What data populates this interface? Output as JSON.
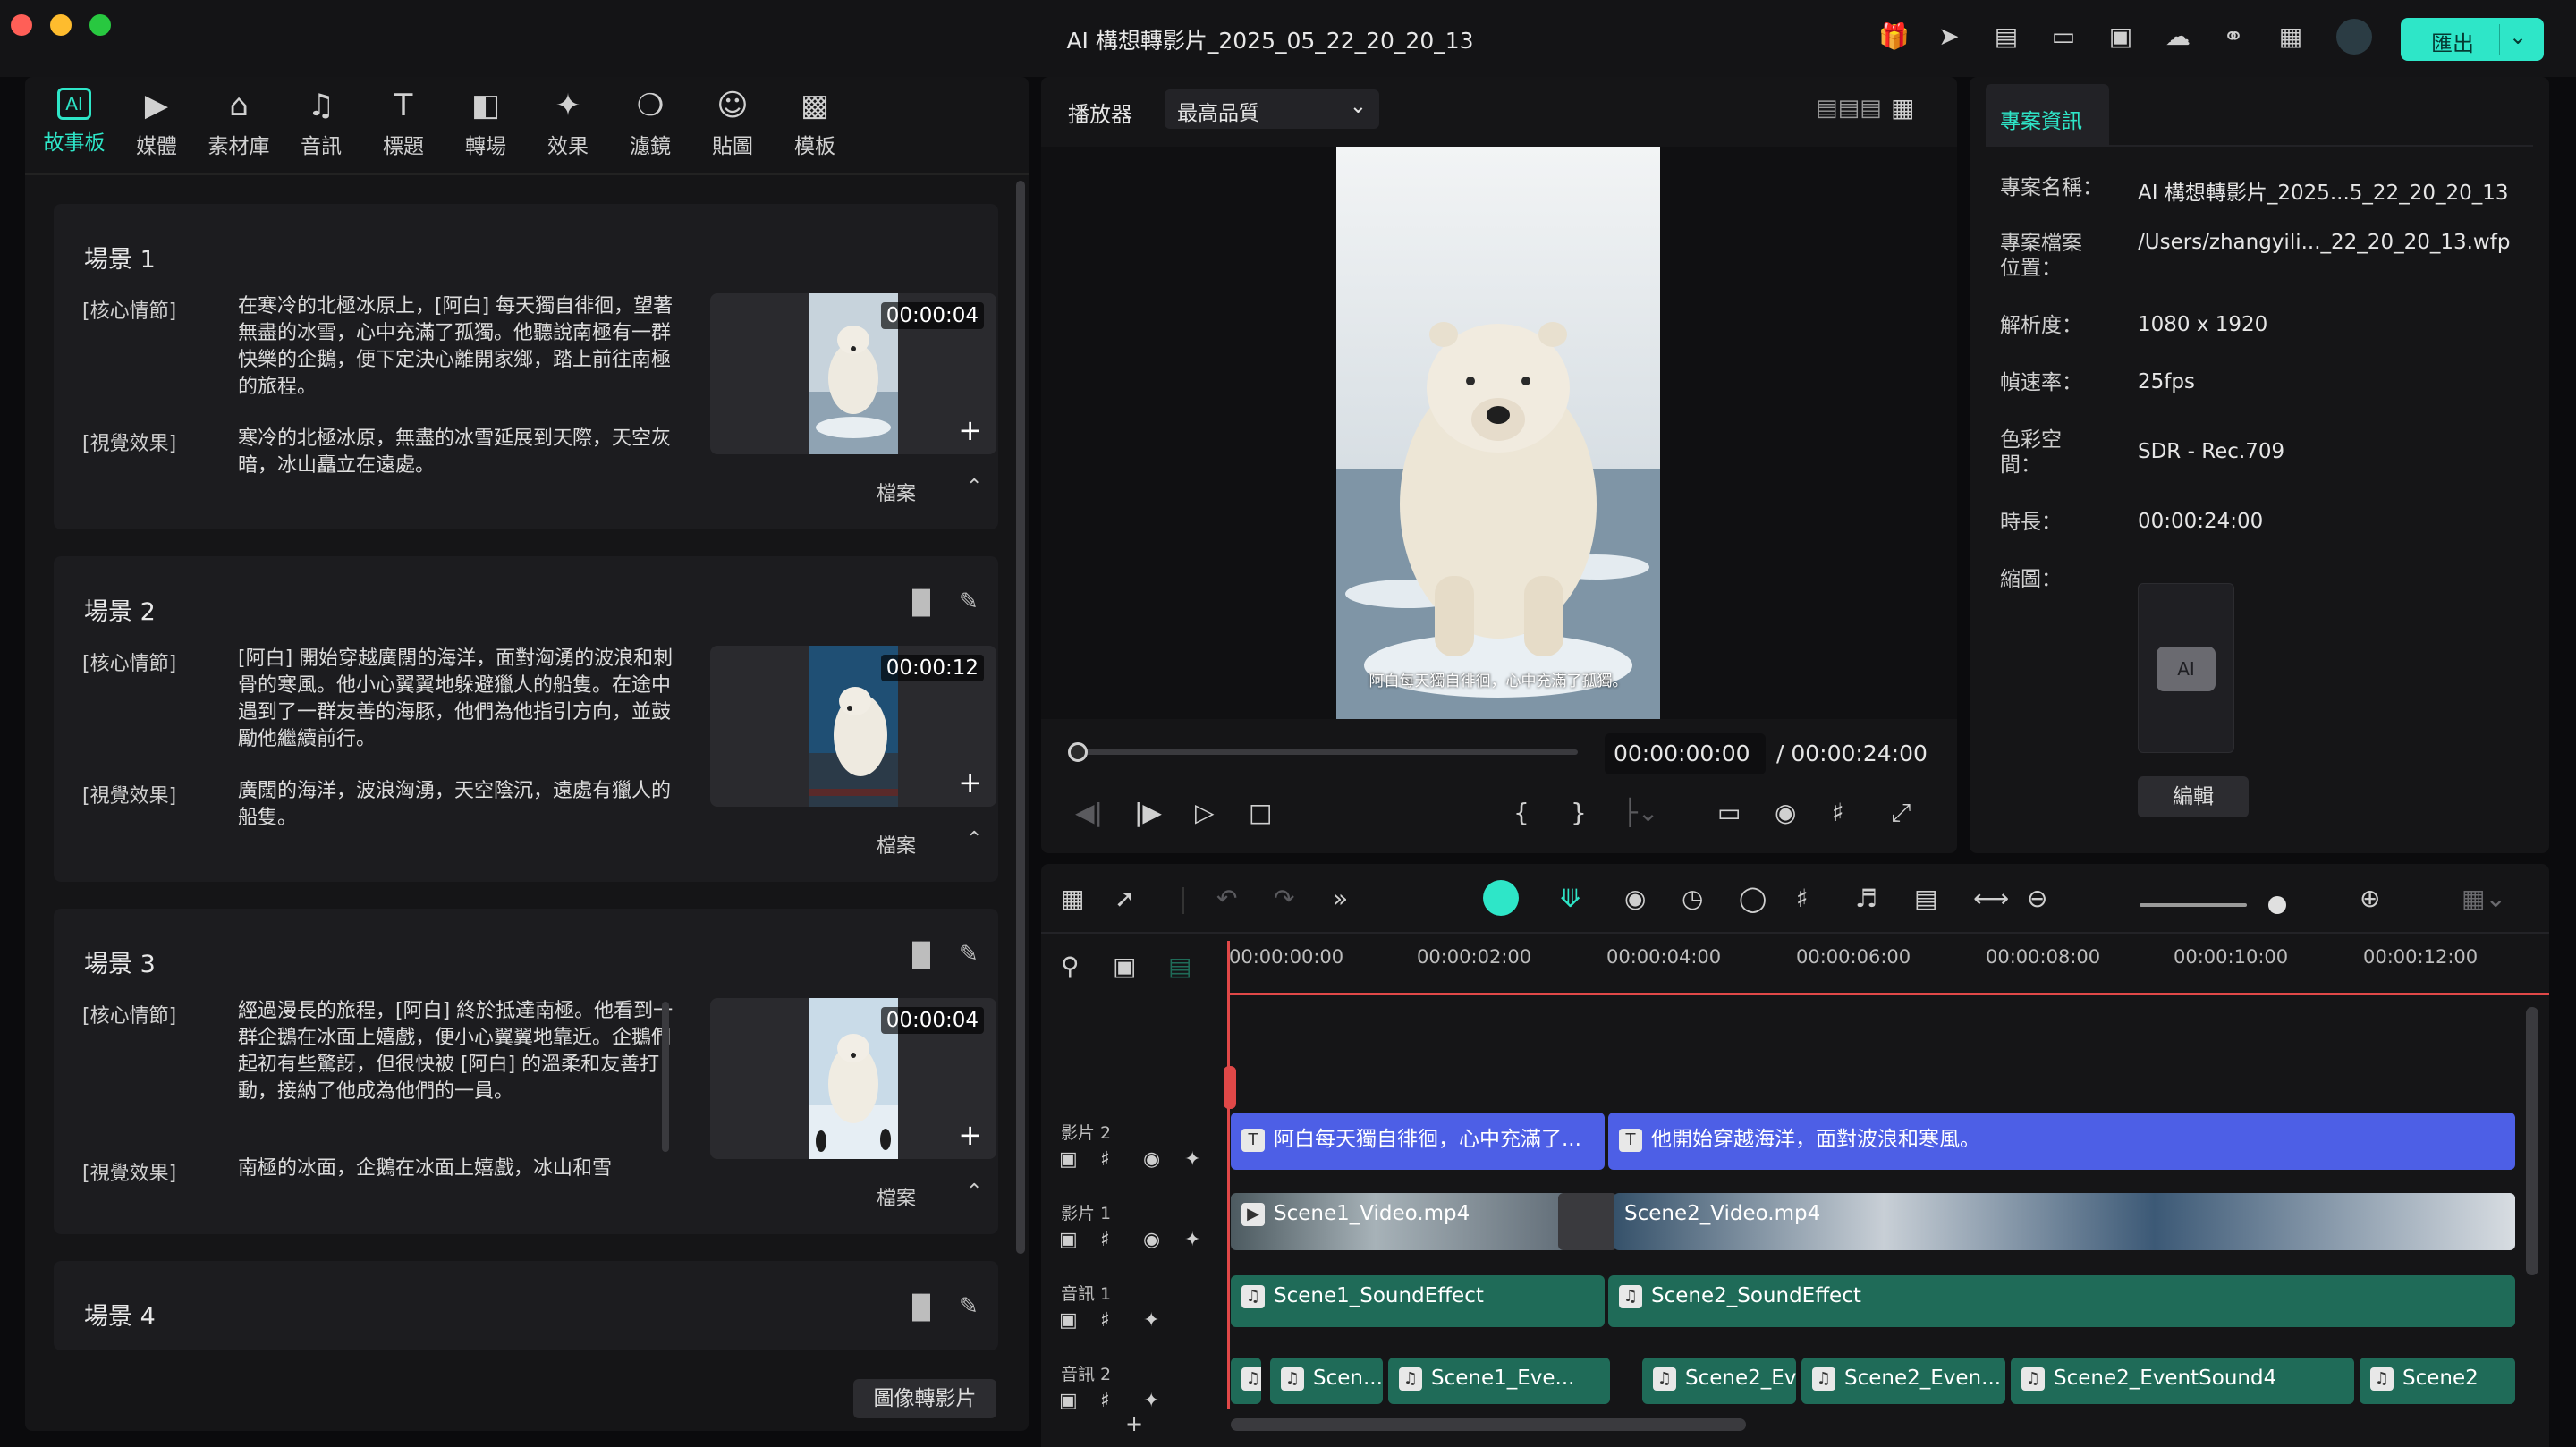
{
  "window": {
    "title": "AI 構想轉影片_2025_05_22_20_20_13",
    "export_label": "匯出"
  },
  "left_tabs": [
    {
      "label": "故事板",
      "icon": "ai-icon"
    },
    {
      "label": "媒體",
      "icon": "media-icon"
    },
    {
      "label": "素材庫",
      "icon": "store-icon"
    },
    {
      "label": "音訊",
      "icon": "music-icon"
    },
    {
      "label": "標題",
      "icon": "title-icon"
    },
    {
      "label": "轉場",
      "icon": "transition-icon"
    },
    {
      "label": "效果",
      "icon": "effects-icon"
    },
    {
      "label": "濾鏡",
      "icon": "filter-icon"
    },
    {
      "label": "貼圖",
      "icon": "sticker-icon"
    },
    {
      "label": "模板",
      "icon": "template-icon"
    }
  ],
  "scenes": [
    {
      "title": "場景 1",
      "core_label": "[核心情節]",
      "core": "在寒冷的北極冰原上，[阿白] 每天獨自徘徊，望著無盡的冰雪，心中充滿了孤獨。他聽說南極有一群快樂的企鵝，便下定決心離開家鄉，踏上前往南極的旅程。",
      "visual_label": "[視覺效果]",
      "visual": "寒冷的北極冰原，無盡的冰雪延展到天際，天空灰暗，冰山矗立在遠處。",
      "duration": "00:00:04",
      "file_label": "檔案"
    },
    {
      "title": "場景 2",
      "core_label": "[核心情節]",
      "core": "[阿白] 開始穿越廣闊的海洋，面對洶湧的波浪和刺骨的寒風。他小心翼翼地躲避獵人的船隻。在途中遇到了一群友善的海豚，他們為他指引方向，並鼓勵他繼續前行。",
      "visual_label": "[視覺效果]",
      "visual": "廣闊的海洋，波浪洶湧，天空陰沉，遠處有獵人的船隻。",
      "duration": "00:00:12",
      "file_label": "檔案"
    },
    {
      "title": "場景 3",
      "core_label": "[核心情節]",
      "core": "經過漫長的旅程，[阿白] 終於抵達南極。他看到一群企鵝在冰面上嬉戲，便小心翼翼地靠近。企鵝們起初有些驚訝，但很快被 [阿白] 的溫柔和友善打動，接納了他成為他們的一員。",
      "visual_label": "[視覺效果]",
      "visual": "南極的冰面，企鵝在冰面上嬉戲，冰山和雪",
      "duration": "00:00:04",
      "file_label": "檔案"
    },
    {
      "title": "場景 4"
    }
  ],
  "img2vid_label": "圖像轉影片",
  "player": {
    "label": "播放器",
    "quality": "最高品質",
    "subtitle": "阿白每天獨自徘徊，心中充滿了孤獨。",
    "current_time": "00:00:00:00",
    "total_time": "/ 00:00:24:00"
  },
  "project_info": {
    "tab": "專案資訊",
    "rows": [
      {
        "key": "專案名稱：",
        "value": "AI 構想轉影片_2025...5_22_20_20_13"
      },
      {
        "key": "專案檔案位置：",
        "value": "/Users/zhangyili..._22_20_20_13.wfp"
      },
      {
        "key": "解析度：",
        "value": "1080 x 1920"
      },
      {
        "key": "幀速率：",
        "value": "25fps"
      },
      {
        "key": "色彩空間：",
        "value": "SDR - Rec.709"
      },
      {
        "key": "時長：",
        "value": "00:00:24:00"
      },
      {
        "key": "縮圖：",
        "value": ""
      }
    ],
    "edit_label": "編輯"
  },
  "timeline": {
    "ruler": [
      "00:00:00:00",
      "00:00:02:00",
      "00:00:04:00",
      "00:00:06:00",
      "00:00:08:00",
      "00:00:10:00",
      "00:00:12:00"
    ],
    "tracks": [
      {
        "label": "影片 2",
        "clips": [
          "阿白每天獨自徘徊，心中充滿了...",
          "他開始穿越海洋，面對波浪和寒風。"
        ]
      },
      {
        "label": "影片 1",
        "clips": [
          "Scene1_Video.mp4",
          "Scene2_Video.mp4"
        ]
      },
      {
        "label": "音訊 1",
        "clips": [
          "Scene1_SoundEffect",
          "Scene2_SoundEffect"
        ]
      },
      {
        "label": "音訊 2",
        "clips": [
          "Scen...",
          "Scene1_Eve...",
          "Scene2_Eve...",
          "Scene2_Even...",
          "Scene2_EventSound4",
          "Scene2"
        ]
      }
    ]
  },
  "colors": {
    "accent": "#2ee6c8",
    "title_clip": "#4d5fe6",
    "video_clip": "#1f6b58",
    "playhead": "#e04848"
  }
}
